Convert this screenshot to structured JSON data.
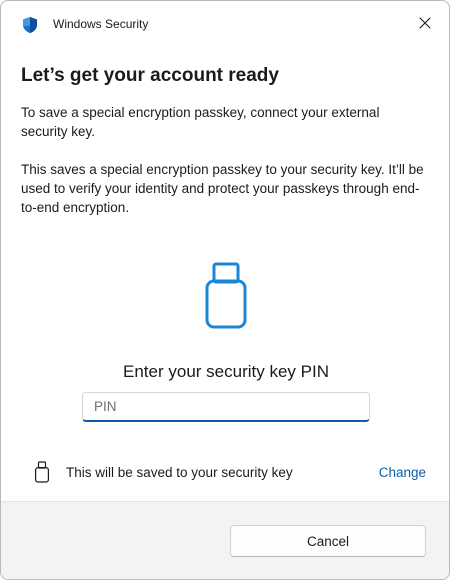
{
  "window": {
    "title": "Windows Security",
    "app_icon": "shield-icon",
    "close_icon": "close-icon"
  },
  "content": {
    "heading": "Let’s get your account ready",
    "paragraph1": "To save a special encryption passkey, connect your external security key.",
    "paragraph2": "This saves a special encryption passkey to your security key. It’ll be used to verify your identity and protect your passkeys through end-to-end encryption.",
    "illustration_icon": "usb-security-key-icon",
    "pin_label": "Enter your security key PIN",
    "pin_input": {
      "placeholder": "PIN",
      "value": ""
    },
    "save_location": {
      "icon": "usb-security-key-icon",
      "text": "This will be saved to your security key",
      "change_label": "Change"
    }
  },
  "footer": {
    "cancel_label": "Cancel"
  },
  "colors": {
    "accent": "#0b5cad",
    "illustration_blue": "#1a86d8",
    "footer_bg": "#f3f3f3"
  }
}
